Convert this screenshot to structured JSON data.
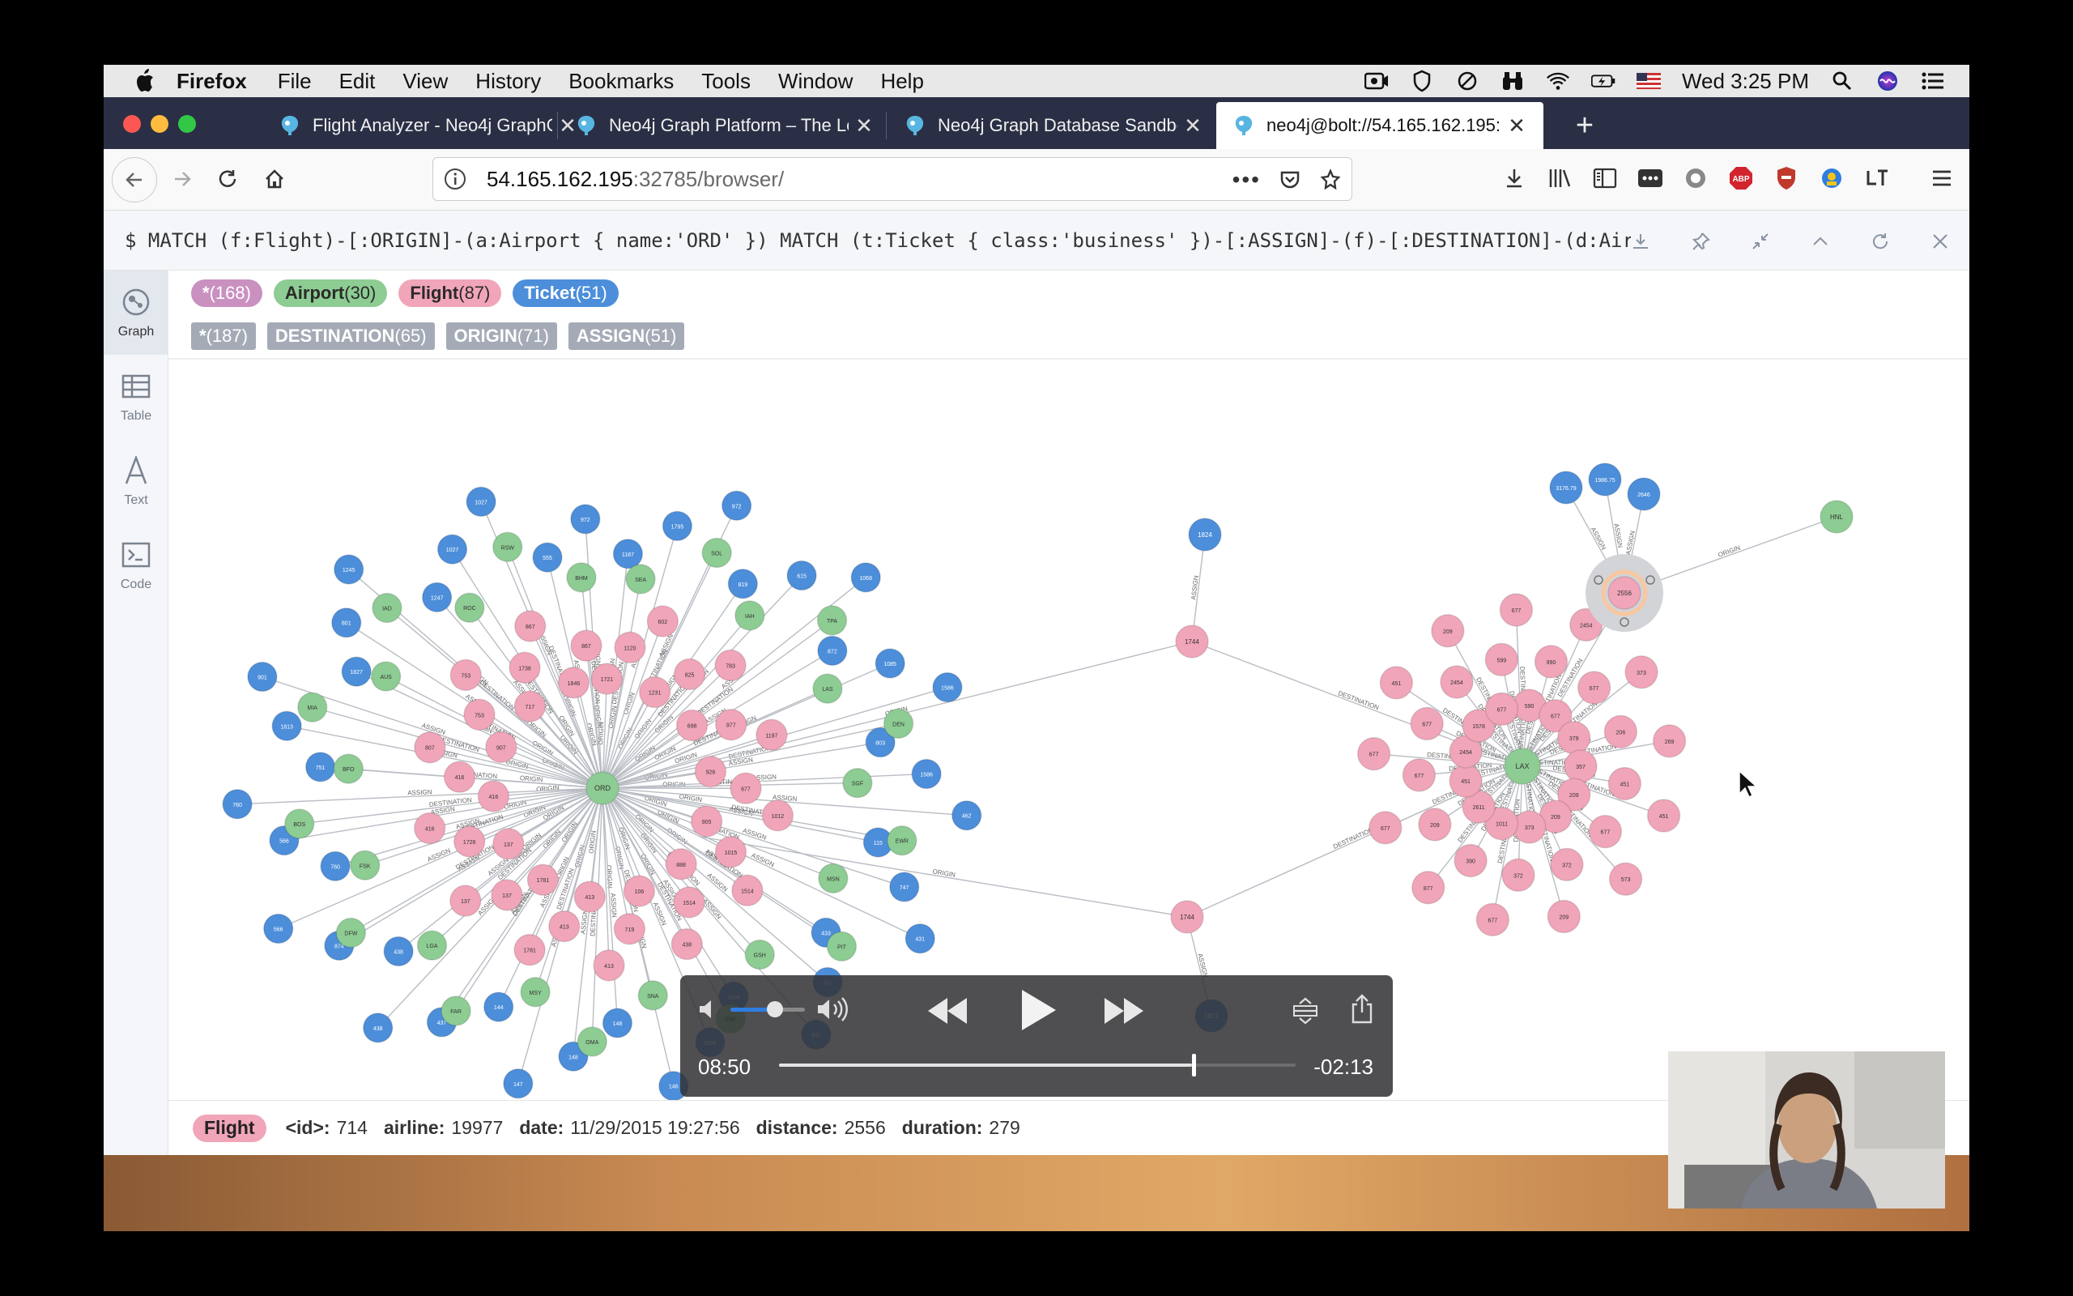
{
  "menubar": {
    "app_name": "Firefox",
    "items": [
      "File",
      "Edit",
      "View",
      "History",
      "Bookmarks",
      "Tools",
      "Window",
      "Help"
    ],
    "clock": "Wed 3:25 PM"
  },
  "tabs": [
    {
      "title": "Flight Analyzer - Neo4j GraphG"
    },
    {
      "title": "Neo4j Graph Platform – The Lea"
    },
    {
      "title": "Neo4j Graph Database Sandbox"
    },
    {
      "title": "neo4j@bolt://54.165.162.195:32"
    }
  ],
  "navbar": {
    "url_host": "54.165.162.195",
    "url_rest": ":32785/browser/"
  },
  "editor": {
    "query": "$ MATCH (f:Flight)-[:ORIGIN]-(a:Airport { name:'ORD' }) MATCH (t:Ticket { class:'business' })-[:ASSIGN]-(f)-[:DESTINATION]-(d:Air…"
  },
  "sidebar": {
    "items": [
      {
        "label": "Graph"
      },
      {
        "label": "Table"
      },
      {
        "label": "Text"
      },
      {
        "label": "Code"
      }
    ]
  },
  "legend": {
    "labels": [
      {
        "name": "*",
        "count": "(168)",
        "color": "#c990c0",
        "text_color": "#ffffff"
      },
      {
        "name": "Airport",
        "count": "(30)",
        "color": "#8dcc93",
        "text_color": "#2a2a2a"
      },
      {
        "name": "Flight",
        "count": "(87)",
        "color": "#f1a5b9",
        "text_color": "#2a2a2a"
      },
      {
        "name": "Ticket",
        "count": "(51)",
        "color": "#4c8eda",
        "text_color": "#ffffff"
      }
    ],
    "relationships": [
      {
        "name": "*",
        "count": "(187)"
      },
      {
        "name": "DESTINATION",
        "count": "(65)"
      },
      {
        "name": "ORIGIN",
        "count": "(71)"
      },
      {
        "name": "ASSIGN",
        "count": "(51)"
      }
    ]
  },
  "graph": {
    "colors": {
      "airport": "#8dcc93",
      "flight": "#f1a5b9",
      "ticket": "#4c8eda"
    },
    "hubs": [
      {
        "label": "ORD"
      },
      {
        "label": "LAX"
      }
    ],
    "ord_airports": [
      "SEA",
      "SOL",
      "IAH",
      "TPA",
      "LAS",
      "DEN",
      "SGF",
      "EWR",
      "MSN",
      "PIT",
      "GSH",
      "SMF",
      "SNA",
      "OMA",
      "MSY",
      "FAR",
      "LGA",
      "DFW",
      "FSK",
      "BOS",
      "BFO",
      "MIA",
      "AUS",
      "IAD",
      "ROC",
      "RSW",
      "BHM"
    ],
    "ord_flight_labels": [
      "1721",
      "1120",
      "602",
      "1231",
      "825",
      "783",
      "698",
      "977",
      "1197",
      "926",
      "677",
      "1012",
      "905",
      "1015",
      "1514",
      "888",
      "1514",
      "438",
      "106",
      "719",
      "413",
      "413",
      "413",
      "1781",
      "1781",
      "137",
      "137",
      "137",
      "1726",
      "416",
      "416",
      "416",
      "807",
      "907",
      "753",
      "753",
      "717",
      "1738",
      "867",
      "1846",
      "867"
    ],
    "ord_ticket_labels": [
      "1187",
      "1795",
      "972",
      "819",
      "615",
      "1068",
      "872",
      "1085",
      "1586",
      "803",
      "1586",
      "462",
      "115",
      "747",
      "431",
      "433",
      "431",
      "432",
      "1808",
      "1808",
      "146",
      "148",
      "148",
      "147",
      "144",
      "437",
      "438",
      "438",
      "874",
      "566",
      "760",
      "566",
      "760",
      "751",
      "1813",
      "901",
      "1827",
      "801",
      "1245",
      "1247",
      "1027",
      "1027",
      "555",
      "972"
    ],
    "mid_flights": [
      {
        "label": "1744"
      },
      {
        "label": "1744"
      }
    ],
    "mid_tickets": [
      {
        "label": "1824"
      },
      {
        "label": "1821"
      }
    ],
    "lax_flight_labels": [
      "590",
      "990",
      "2454",
      "677",
      "677",
      "373",
      "379",
      "206",
      "269",
      "357",
      "451",
      "451",
      "209",
      "677",
      "573",
      "209",
      "372",
      "209",
      "373",
      "372",
      "677",
      "1011",
      "390",
      "877",
      "2611",
      "209",
      "677",
      "451",
      "677",
      "677",
      "2454",
      "677",
      "451",
      "1578",
      "2454",
      "209",
      "677",
      "599",
      "677"
    ],
    "selected_flight": {
      "label": "2556"
    },
    "selected_tickets": [
      {
        "label": "3176.79"
      },
      {
        "label": "1986.75"
      },
      {
        "label": "2646"
      }
    ],
    "hnl_airport": {
      "label": "HNL"
    },
    "edge_labels": {
      "destination": "DESTINATION",
      "origin": "ORIGIN",
      "assign": "ASSIGN"
    }
  },
  "status": {
    "label": "Flight",
    "fields": [
      {
        "key": "<id>:",
        "value": "714"
      },
      {
        "key": "airline:",
        "value": "19977"
      },
      {
        "key": "date:",
        "value": "11/29/2015 19:27:56"
      },
      {
        "key": "distance:",
        "value": "2556"
      },
      {
        "key": "duration:",
        "value": "279"
      }
    ]
  },
  "video": {
    "elapsed": "08:50",
    "remaining": "-02:13",
    "progress": 0.8,
    "volume": 0.6
  }
}
